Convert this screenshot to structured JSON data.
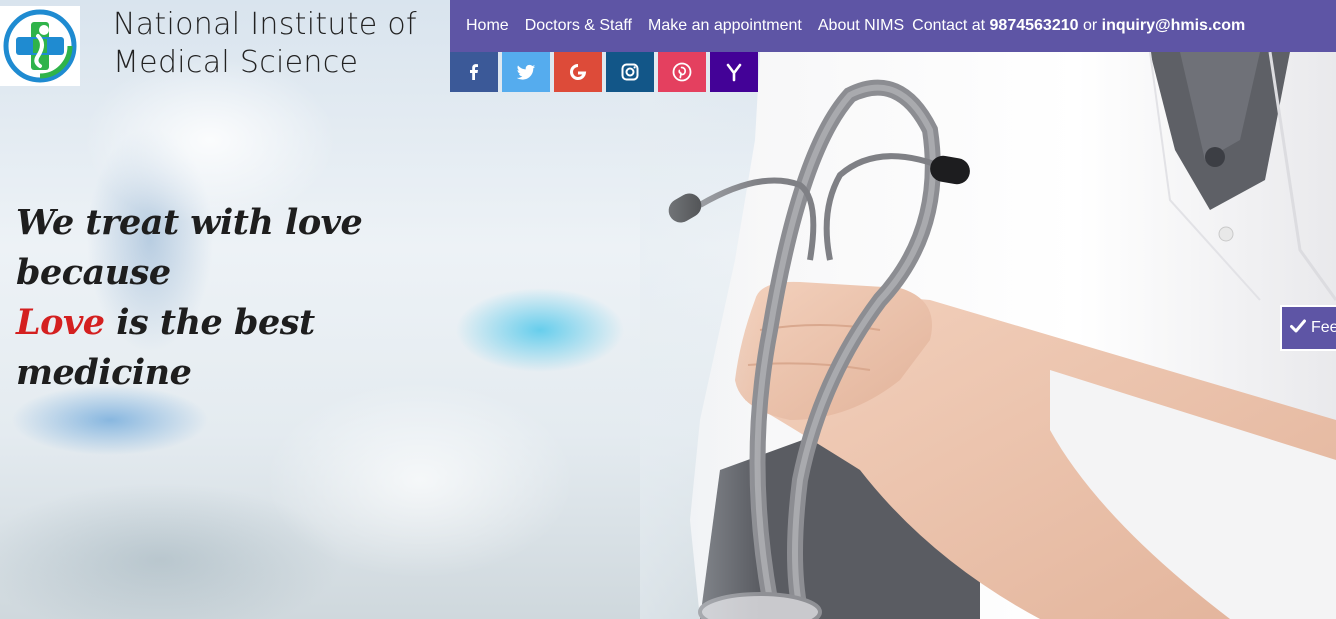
{
  "brand": {
    "line1": "National Institute of",
    "line2": "Medical Science"
  },
  "nav": {
    "items": [
      "Home",
      "Doctors & Staff",
      "Make an appointment",
      "About NIMS"
    ],
    "contact_prefix": "Contact at",
    "phone": "9874563210",
    "contact_or": "or",
    "email": "inquiry@hmis.com"
  },
  "social": [
    {
      "icon": "facebook-icon",
      "color": "#3b5998",
      "glyph": "f"
    },
    {
      "icon": "twitter-icon",
      "color": "#55acee",
      "glyph": ""
    },
    {
      "icon": "google-icon",
      "color": "#dd4b39",
      "glyph": "G"
    },
    {
      "icon": "instagram-icon",
      "color": "#125688",
      "glyph": ""
    },
    {
      "icon": "pinterest-icon",
      "color": "#e4405f",
      "glyph": ""
    },
    {
      "icon": "yahoo-icon",
      "color": "#430297",
      "glyph": "Y"
    }
  ],
  "tagline": {
    "line1": "We treat with love because",
    "love_word": "Love",
    "line2_rest": " is the best medicine"
  },
  "feedback": {
    "label": "Fee"
  },
  "colors": {
    "nav_bg": "#5e55a5",
    "love_accent": "#d42020"
  }
}
